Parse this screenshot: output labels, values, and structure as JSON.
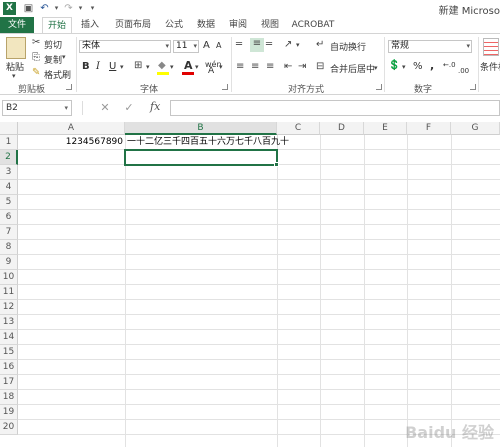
{
  "titlebar": {
    "app_icon": "excel-logo-icon",
    "app_letter": "X",
    "window_title": "新建 Microso",
    "quick_access": [
      {
        "name": "save-icon",
        "glyph": "💾"
      },
      {
        "name": "undo-icon",
        "glyph": "↶"
      },
      {
        "name": "redo-icon",
        "glyph": "↷"
      },
      {
        "name": "customize-qa-icon",
        "glyph": "▾"
      }
    ]
  },
  "tabs": [
    "文件",
    "开始",
    "插入",
    "页面布局",
    "公式",
    "数据",
    "审阅",
    "视图",
    "ACROBAT"
  ],
  "active_tab": "开始",
  "ribbon": {
    "clipboard": {
      "paste_label": "粘贴",
      "cut_label": "剪切",
      "copy_label": "复制",
      "format_painter_label": "格式刷",
      "group_label": "剪贴板"
    },
    "font": {
      "font_name": "宋体",
      "font_size": "11",
      "grow_label": "A",
      "shrink_label": "A",
      "bold": "B",
      "italic": "I",
      "underline": "U",
      "font_color_label": "A",
      "highlight_label": "A",
      "wen_label": "wén",
      "group_label": "字体"
    },
    "alignment": {
      "wrap_text_label": "自动换行",
      "merge_center_label": "合并后居中",
      "group_label": "对齐方式"
    },
    "number": {
      "format_value": "常规",
      "percent_label": "%",
      "comma_label": ",",
      "increase_decimal_label": "←.0",
      "decrease_decimal_label": ".00",
      "group_label": "数字"
    },
    "styles": {
      "conditional_label": "条件格"
    }
  },
  "formula_bar": {
    "name_box": "B2",
    "cancel": "✕",
    "enter": "✓",
    "fx": "fx",
    "formula": ""
  },
  "sheet": {
    "columns": [
      "A",
      "B",
      "C",
      "D",
      "E",
      "F",
      "G"
    ],
    "selected_column": "B",
    "rows": [
      "1",
      "2",
      "3",
      "4",
      "5",
      "6",
      "7",
      "8",
      "9",
      "10",
      "11",
      "12",
      "13",
      "14",
      "15",
      "16",
      "17",
      "18",
      "19",
      "20"
    ],
    "selected_row": "2",
    "cells": {
      "A1": "1234567890",
      "B1": "一十二亿三千四百五十六万七千八百九十"
    },
    "active_cell": "B2"
  },
  "watermark": "Baidu 经验",
  "colors": {
    "accent": "#217346"
  }
}
